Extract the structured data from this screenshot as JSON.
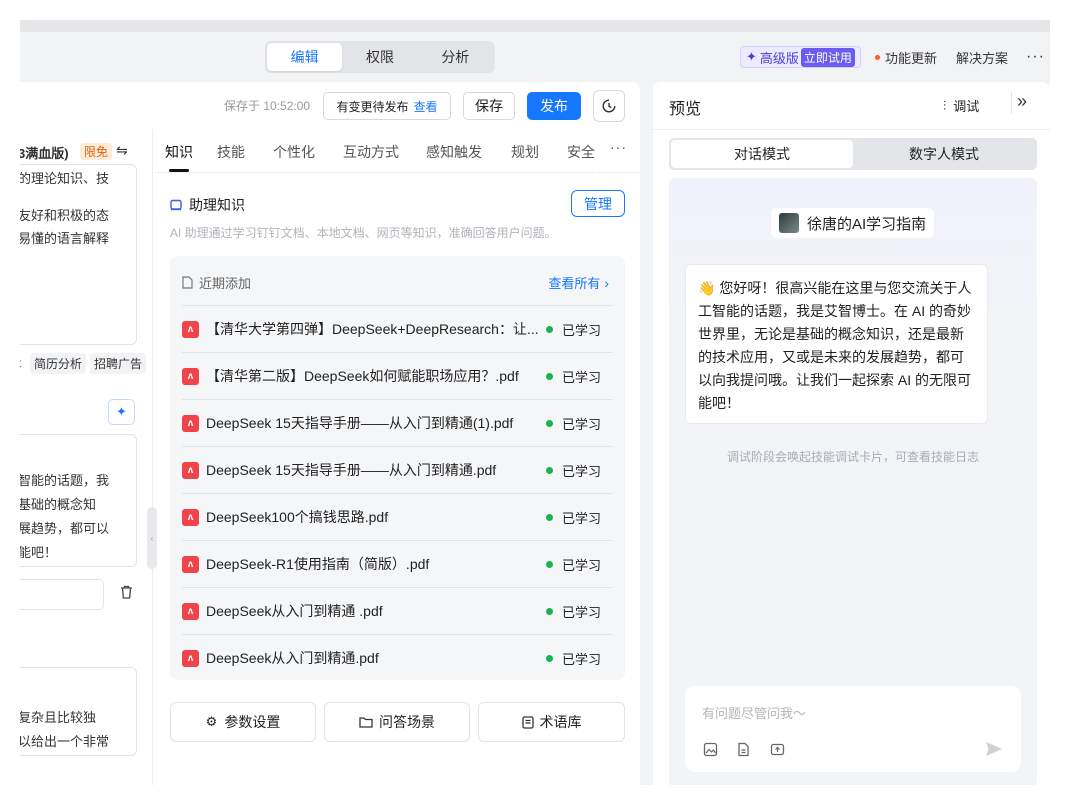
{
  "topbar": {
    "tabs": [
      "编辑",
      "权限",
      "分析"
    ],
    "pro_label": "高级版",
    "pro_tag": "立即试用",
    "update_label": "功能更新",
    "solutions_label": "解决方案"
  },
  "editor": {
    "saved_at": "保存于 10:52:00",
    "pending_label": "有变更待发布",
    "pending_link": "查看",
    "save_label": "保存",
    "publish_label": "发布"
  },
  "left_panel": {
    "model_name": "3满血版)",
    "free_badge": "限免",
    "intro_lines": [
      "的理论知识、技",
      "友好和积极的态",
      "易懂的语言解释"
    ],
    "chips": [
      "t",
      "简历分析",
      "招聘广告"
    ],
    "opener_lines": [
      "智能的话题，我",
      "基础的概念知",
      "展趋势，都可以",
      "能吧！"
    ],
    "bottom_lines": [
      "复杂且比较独",
      "以给出一个非常"
    ]
  },
  "tabs": [
    "知识",
    "技能",
    "个性化",
    "互动方式",
    "感知触发",
    "规划",
    "安全"
  ],
  "knowledge": {
    "title": "助理知识",
    "manage_label": "管理",
    "description": "AI 助理通过学习钉钉文档、本地文档、网页等知识，准确回答用户问题。",
    "recent_label": "近期添加",
    "view_all_label": "查看所有",
    "files": [
      {
        "name": "【清华大学第四弹】DeepSeek+DeepResearch：让...",
        "status": "已学习"
      },
      {
        "name": "【清华第二版】DeepSeek如何赋能职场应用？.pdf",
        "status": "已学习"
      },
      {
        "name": "DeepSeek 15天指导手册——从入门到精通(1).pdf",
        "status": "已学习"
      },
      {
        "name": "DeepSeek 15天指导手册——从入门到精通.pdf",
        "status": "已学习"
      },
      {
        "name": "DeepSeek100个搞钱思路.pdf",
        "status": "已学习"
      },
      {
        "name": "DeepSeek-R1使用指南（简版）.pdf",
        "status": "已学习"
      },
      {
        "name": "DeepSeek从入门到精通 .pdf",
        "status": "已学习"
      },
      {
        "name": "DeepSeek从入门到精通.pdf",
        "status": "已学习"
      }
    ],
    "bottom_buttons": [
      "参数设置",
      "问答场景",
      "术语库"
    ]
  },
  "preview": {
    "title": "预览",
    "debug_label": "调试",
    "modes": [
      "对话模式",
      "数字人模式"
    ],
    "assistant_name": "徐唐的AI学习指南",
    "greeting_lines": [
      "👋 您好呀！很高兴能在这里与您交流关于人",
      "工智能的话题，我是艾智博士。在 AI 的奇妙",
      "世界里，无论是基础的概念知识，还是最新",
      "的技术应用，又或是未来的发展趋势，都可",
      "以向我提问哦。让我们一起探索 AI 的无限可",
      "能吧！"
    ],
    "debug_hint": "调试阶段会唤起技能调试卡片，可查看技能日志",
    "input_placeholder": "有问题尽管问我～"
  },
  "colors": {
    "accent": "#1677ff",
    "pdf_red": "#f0444a",
    "learned_green": "#16b350",
    "pro_purple": "#6a5bf1"
  }
}
